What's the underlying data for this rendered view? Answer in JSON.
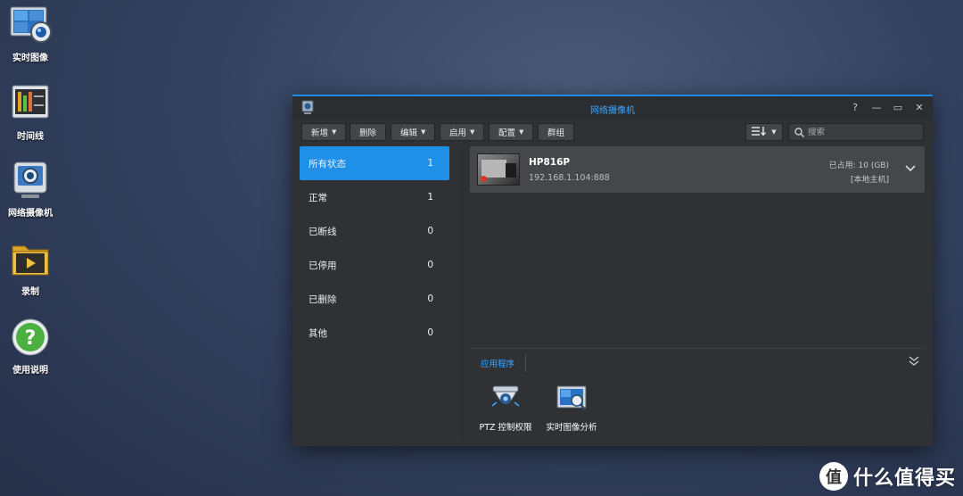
{
  "desktop": {
    "icons": [
      {
        "label": "实时图像",
        "icon": "live-view-icon"
      },
      {
        "label": "时间线",
        "icon": "timeline-icon"
      },
      {
        "label": "网络摄像机",
        "icon": "ip-camera-icon"
      },
      {
        "label": "录制",
        "icon": "recording-icon"
      },
      {
        "label": "使用说明",
        "icon": "help-icon"
      }
    ]
  },
  "window": {
    "title": "网络摄像机",
    "controls": [
      "?",
      "—",
      "▭",
      "✕"
    ]
  },
  "toolbar": {
    "buttons": [
      {
        "label": "新增",
        "dropdown": true
      },
      {
        "label": "删除",
        "dropdown": false
      },
      {
        "label": "编辑",
        "dropdown": true
      },
      {
        "label": "启用",
        "dropdown": true
      },
      {
        "label": "配置",
        "dropdown": true
      },
      {
        "label": "群组",
        "dropdown": false
      }
    ],
    "search_placeholder": "搜索"
  },
  "sidebar": {
    "items": [
      {
        "label": "所有状态",
        "count": "1",
        "active": true
      },
      {
        "label": "正常",
        "count": "1"
      },
      {
        "label": "已断线",
        "count": "0"
      },
      {
        "label": "已停用",
        "count": "0"
      },
      {
        "label": "已删除",
        "count": "0"
      },
      {
        "label": "其他",
        "count": "0"
      }
    ]
  },
  "camera": {
    "name": "HP816P",
    "ip": "192.168.1.104:888",
    "usage": "已占用:  10 (GB)",
    "host": "[本地主机]"
  },
  "applications": {
    "tab_label": "应用程序",
    "items": [
      {
        "label": "PTZ 控制权限",
        "icon": "ptz-camera-icon"
      },
      {
        "label": "实时图像分析",
        "icon": "live-analytics-icon"
      }
    ]
  },
  "watermark": {
    "badge": "值",
    "text": "什么值得买"
  },
  "colors": {
    "accent": "#1e90e8",
    "title_accent": "#3ea6ff",
    "window_bg": "#2f3134"
  }
}
